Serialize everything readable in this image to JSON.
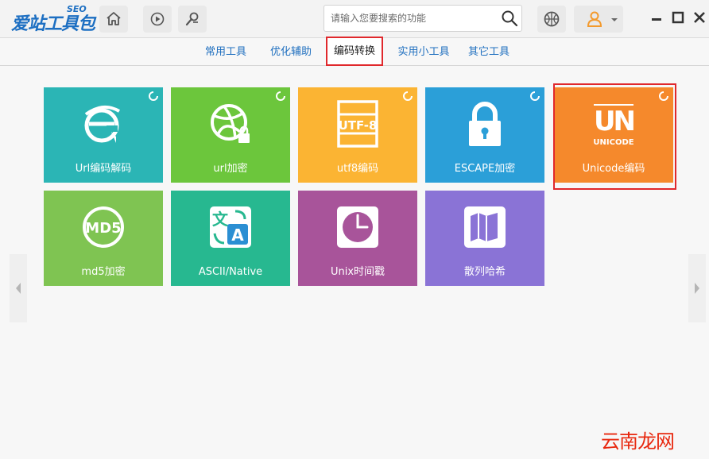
{
  "app": {
    "logo_text": "爱站工具包",
    "logo_badge": "SEO"
  },
  "search": {
    "placeholder": "请输入您要搜索的功能"
  },
  "tabs": [
    {
      "label": "常用工具"
    },
    {
      "label": "优化辅助"
    },
    {
      "label": "编码转换",
      "active": true
    },
    {
      "label": "实用小工具"
    },
    {
      "label": "其它工具"
    }
  ],
  "tiles": [
    {
      "label": "Url编码解码",
      "color": "#2bb5b5",
      "icon": "ie-icon"
    },
    {
      "label": "url加密",
      "color": "#6cc63c",
      "icon": "dribbble-lock-icon"
    },
    {
      "label": "utf8编码",
      "color": "#fbb433",
      "icon": "utf8-icon"
    },
    {
      "label": "ESCAPE加密",
      "color": "#2b9fd8",
      "icon": "lock-icon"
    },
    {
      "label": "Unicode编码",
      "color": "#f5892c",
      "icon": "unicode-icon"
    },
    {
      "label": "md5加密",
      "color": "#7fc452",
      "icon": "md5-icon"
    },
    {
      "label": "ASCII/Native",
      "color": "#27b890",
      "icon": "translate-icon"
    },
    {
      "label": "Unix时间戳",
      "color": "#a8549a",
      "icon": "clock-icon"
    },
    {
      "label": "散列哈希",
      "color": "#8a73d6",
      "icon": "map-icon"
    }
  ],
  "icon_text": {
    "utf8": "UTF-8",
    "unicode_big": "UN",
    "unicode_small": "UNICODE",
    "md5": "MD5",
    "translate_a": "A",
    "translate_zh": "文"
  },
  "watermark": "云南龙网"
}
